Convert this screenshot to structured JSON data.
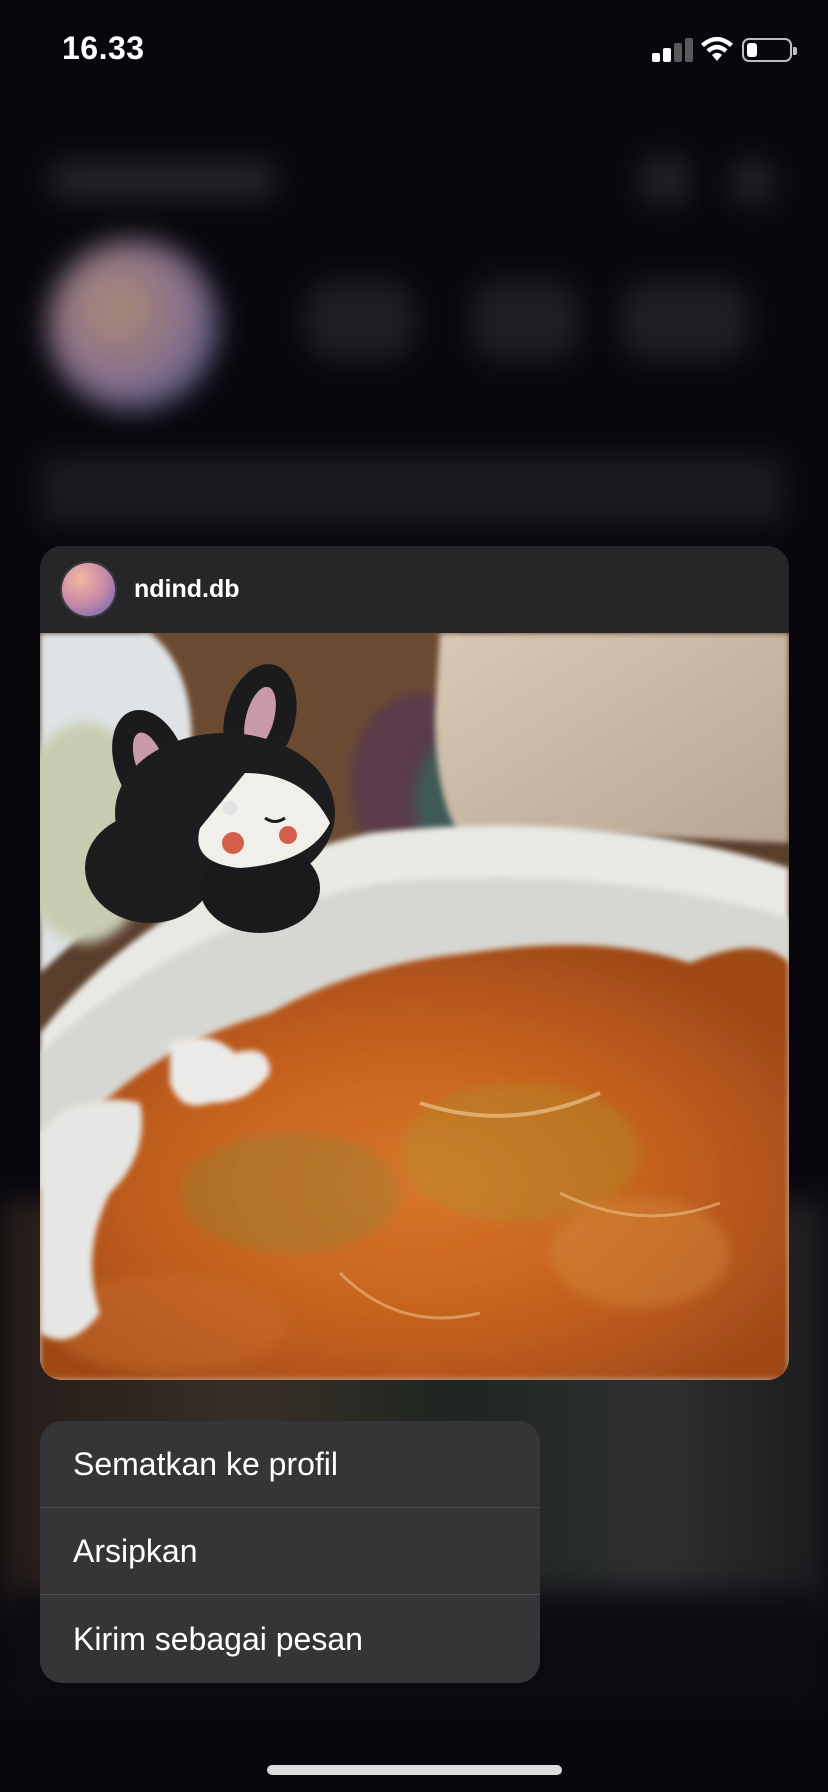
{
  "status_bar": {
    "time": "16.33",
    "battery_level": 0.25,
    "signal_bars_active": 2,
    "signal_bars_total": 4
  },
  "post_preview": {
    "username": "ndind.db",
    "avatar_icon": "profile-avatar",
    "image_icon": "post-photo-plush-bunny-and-food-plate"
  },
  "context_menu": {
    "items": [
      {
        "label": "Sematkan ke profil"
      },
      {
        "label": "Arsipkan"
      },
      {
        "label": "Kirim sebagai pesan"
      }
    ]
  },
  "colors": {
    "background": "#07070d",
    "card": "#262628",
    "menu": "#353537",
    "divider": "#4c4c4f"
  }
}
